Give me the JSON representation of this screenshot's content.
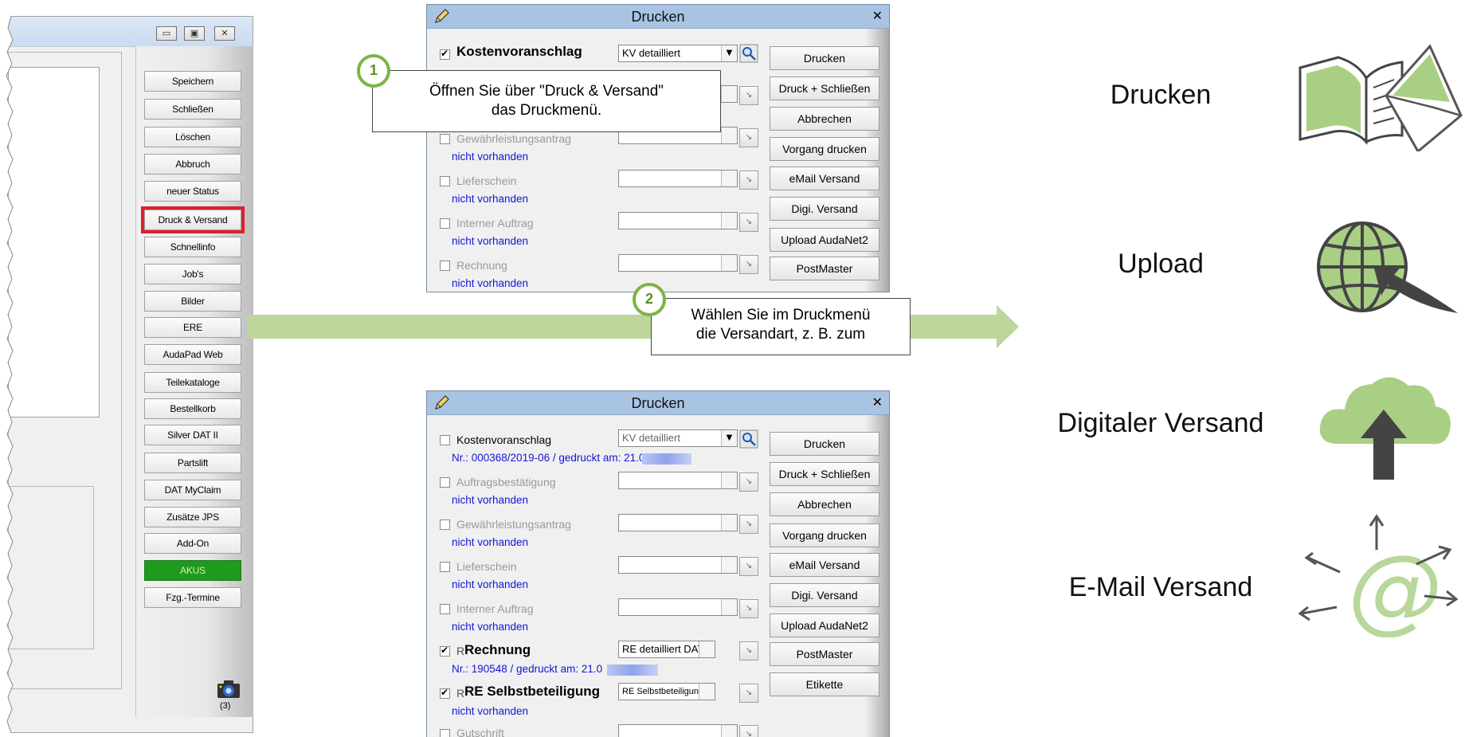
{
  "main_window": {
    "buttons": [
      {
        "label": "Speichern"
      },
      {
        "label": "Schließen"
      },
      {
        "label": "Löschen"
      },
      {
        "label": "Abbruch"
      },
      {
        "label": "neuer Status"
      },
      {
        "label": "Druck & Versand",
        "highlighted": true
      },
      {
        "label": "Schnellinfo"
      },
      {
        "label": "Job's"
      },
      {
        "label": "Bilder"
      },
      {
        "label": "ERE"
      },
      {
        "label": "AudaPad Web"
      },
      {
        "label": "Teilekataloge"
      },
      {
        "label": "Bestellkorb"
      },
      {
        "label": "Silver DAT II"
      },
      {
        "label": "Partslift"
      },
      {
        "label": "DAT MyClaim"
      },
      {
        "label": "Zusätze JPS"
      },
      {
        "label": "Add-On"
      },
      {
        "label": "AKUS",
        "status_color": "#1f9a1f"
      },
      {
        "label": "Fzg.-Termine"
      }
    ],
    "camera_count": "(3)",
    "window_buttons": {
      "minimize": "▭",
      "maximize": "▣",
      "close": "✕"
    }
  },
  "dialog_top": {
    "title": "Drucken",
    "close": "✕",
    "rows": [
      {
        "label": "Kostenvoranschlag",
        "checked": true,
        "bold": true,
        "combo": "KV detailliert",
        "info": ""
      },
      {
        "label": "Gewährleistungsantrag",
        "checked": false,
        "combo": "",
        "info": "nicht vorhanden"
      },
      {
        "label": "Lieferschein",
        "checked": false,
        "combo": "",
        "info": "nicht vorhanden"
      },
      {
        "label": "Interner Auftrag",
        "checked": false,
        "combo": "",
        "info": "nicht vorhanden"
      },
      {
        "label": "Rechnung",
        "checked": false,
        "combo": "",
        "info": "nicht vorhanden"
      }
    ],
    "buttons": [
      "Drucken",
      "Druck + Schließen",
      "Abbrechen",
      "Vorgang drucken",
      "eMail Versand",
      "Digi. Versand",
      "Upload AudaNet2",
      "PostMaster"
    ]
  },
  "dialog_bottom": {
    "title": "Drucken",
    "close": "✕",
    "rows": [
      {
        "label": "Kostenvoranschlag",
        "checked": false,
        "combo": "KV detailliert",
        "info": "Nr.: 000368/2019-06 / gedruckt am: 21.0"
      },
      {
        "label": "Auftragsbestätigung",
        "checked": false,
        "combo": "",
        "info": "nicht vorhanden"
      },
      {
        "label": "Gewährleistungsantrag",
        "checked": false,
        "combo": "",
        "info": "nicht vorhanden"
      },
      {
        "label": "Lieferschein",
        "checked": false,
        "combo": "",
        "info": "nicht vorhanden"
      },
      {
        "label": "Interner Auftrag",
        "checked": false,
        "combo": "",
        "info": "nicht vorhanden"
      },
      {
        "label": "Rechnung",
        "prefix": "R",
        "checked": true,
        "bold": true,
        "combo": "RE detailliert DAT",
        "info": "Nr.: 190548 / gedruckt am: 21.0"
      },
      {
        "label": "RE Selbstbeteiligung",
        "prefix": "R",
        "checked": true,
        "bold": true,
        "combo": "RE Selbstbeteiligung",
        "info": "nicht vorhanden"
      },
      {
        "label": "Gutschrift",
        "checked": false,
        "combo": "",
        "info": ""
      }
    ],
    "buttons": [
      "Drucken",
      "Druck + Schließen",
      "Abbrechen",
      "Vorgang drucken",
      "eMail Versand",
      "Digi. Versand",
      "Upload AudaNet2",
      "PostMaster",
      "Etikette"
    ]
  },
  "callouts": {
    "step1": {
      "number": "1",
      "text_line1": "Öffnen Sie über \"Druck & Versand\"",
      "text_line2": "das Druckmenü."
    },
    "step2": {
      "number": "2",
      "text_line1": "Wählen Sie im Druckmenü",
      "text_line2": "die Versandart, z. B. zum"
    }
  },
  "options": [
    {
      "label": "Drucken",
      "icon": "print-book-envelope-icon"
    },
    {
      "label": "Upload",
      "icon": "globe-upload-icon"
    },
    {
      "label": "Digitaler Versand",
      "icon": "cloud-upload-icon"
    },
    {
      "label": "E-Mail Versand",
      "icon": "email-at-icon"
    }
  ],
  "colors": {
    "accent_green": "#7db443",
    "arrow_green": "#bcd69c",
    "highlight_red": "#d9222b",
    "link_blue": "#1515d8"
  }
}
